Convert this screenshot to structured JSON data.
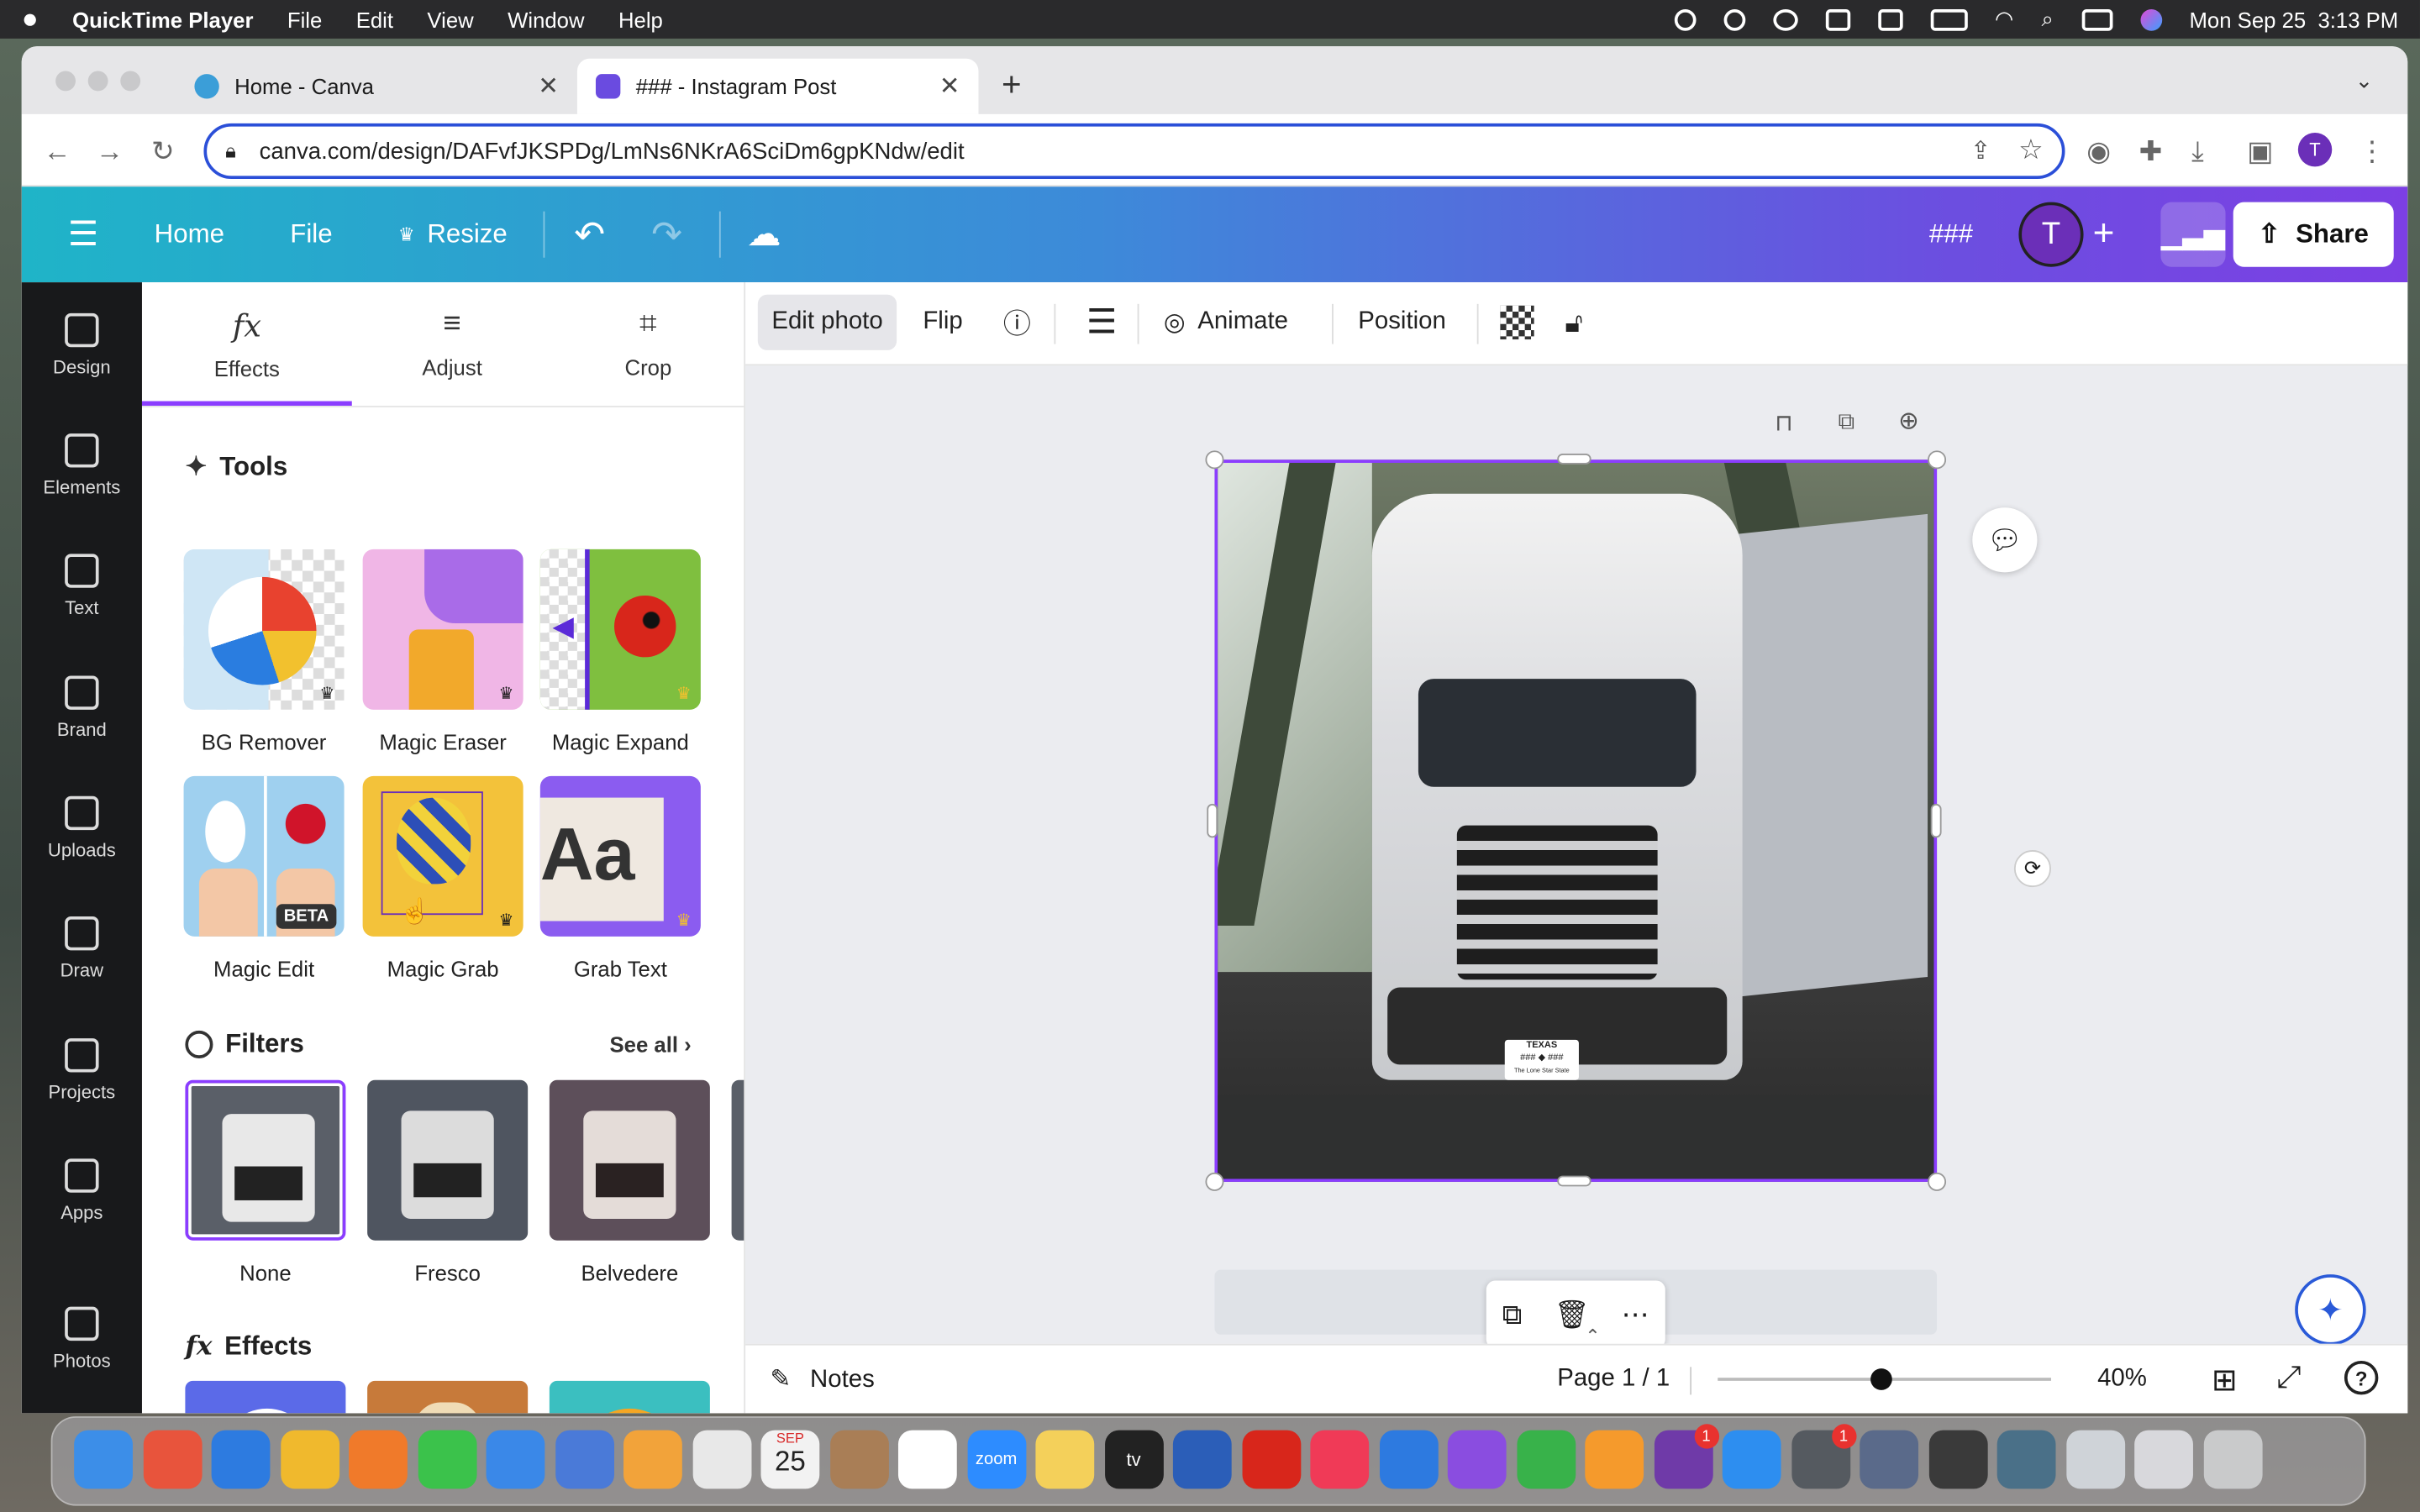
{
  "menubar": {
    "app": "QuickTime Player",
    "items": [
      "File",
      "Edit",
      "View",
      "Window",
      "Help"
    ],
    "clock": "Mon Sep 25  3:13 PM"
  },
  "tabs": [
    {
      "title": "Home - Canva",
      "favicon": "canva-icon"
    },
    {
      "title": "### - Instagram Post",
      "favicon": "heart-icon"
    }
  ],
  "address": {
    "url": "canva.com/design/DAFvfJKSPDg/LmNs6NKrA6SciDm6gpKNdw/edit"
  },
  "header": {
    "menu_icon": "☰",
    "home": "Home",
    "file": "File",
    "resize": "Resize",
    "title": "###",
    "avatar": "T",
    "share": "Share"
  },
  "rail": [
    {
      "label": "Design",
      "icon": "design-icon"
    },
    {
      "label": "Elements",
      "icon": "elements-icon"
    },
    {
      "label": "Text",
      "icon": "text-icon"
    },
    {
      "label": "Brand",
      "icon": "brand-icon"
    },
    {
      "label": "Uploads",
      "icon": "uploads-icon"
    },
    {
      "label": "Draw",
      "icon": "draw-icon"
    },
    {
      "label": "Projects",
      "icon": "projects-icon"
    },
    {
      "label": "Apps",
      "icon": "apps-icon"
    },
    {
      "label": "Photos",
      "icon": "photos-icon"
    }
  ],
  "panel": {
    "tabs": [
      "Effects",
      "Adjust",
      "Crop"
    ],
    "tab_icons": [
      "fx",
      "≡",
      "⌗"
    ],
    "tools_heading": "Tools",
    "tools": [
      "BG Remover",
      "Magic Eraser",
      "Magic Expand",
      "Magic Edit",
      "Magic Grab",
      "Grab Text"
    ],
    "beta_badge": "BETA",
    "grabtext_sample": "Aa",
    "filters_heading": "Filters",
    "see_all": "See all",
    "filters": [
      "None",
      "Fresco",
      "Belvedere"
    ],
    "effects_heading": "Effects",
    "fx_glyph": "fx"
  },
  "toolbar": {
    "edit_photo": "Edit photo",
    "flip": "Flip",
    "animate": "Animate",
    "position": "Position"
  },
  "plate": {
    "state": "TEXAS",
    "number": "### ◆ ###",
    "slogan": "The Lone Star State"
  },
  "bottom": {
    "notes": "Notes",
    "page": "Page 1 / 1",
    "zoom": "40%",
    "zoom_level": 0.49
  },
  "dock": {
    "calendar_month": "SEP",
    "calendar_day": "25",
    "zoom_label": "zoom",
    "tv_label": "tv",
    "badge": "1"
  },
  "colors": {
    "accent": "#8b3dff",
    "url_border": "#2b4fd8"
  }
}
